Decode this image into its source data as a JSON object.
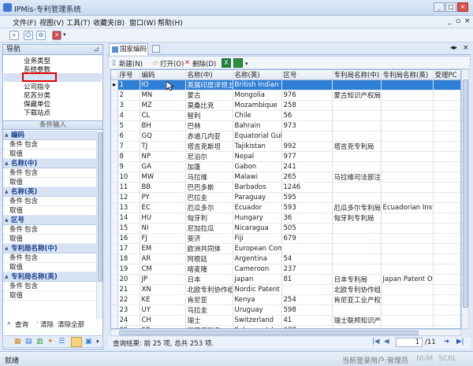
{
  "window": {
    "title": "IPMis-专利管理系统",
    "min": "_",
    "max": "□",
    "close": "×"
  },
  "menu": [
    "文件(F)",
    "视图(V)",
    "工具(T)",
    "收藏夹(B)",
    "窗口(W)",
    "帮助(H)"
  ],
  "nav": {
    "title": "导航",
    "items": [
      "业务类型",
      "系统参数",
      "",
      "公司指令",
      "尼苏分类",
      "保藏单位",
      "下载站点"
    ]
  },
  "conditions": {
    "title": "条件输入",
    "groups": [
      {
        "name": "编码",
        "rows": [
          [
            "条件",
            "包含"
          ],
          [
            "取值",
            ""
          ]
        ]
      },
      {
        "name": "名称(中)",
        "rows": [
          [
            "条件",
            "包含"
          ],
          [
            "取值",
            ""
          ]
        ]
      },
      {
        "name": "名称(英)",
        "rows": [
          [
            "条件",
            "包含"
          ],
          [
            "取值",
            ""
          ]
        ]
      },
      {
        "name": "区号",
        "rows": [
          [
            "条件",
            "包含"
          ],
          [
            "取值",
            ""
          ]
        ]
      },
      {
        "name": "专利局名称(中)",
        "rows": [
          [
            "条件",
            "包含"
          ],
          [
            "取值",
            ""
          ]
        ]
      },
      {
        "name": "专利局名称(英)",
        "rows": [
          [
            "条件",
            "包含"
          ],
          [
            "取值",
            ""
          ]
        ]
      }
    ],
    "query": "查询",
    "clear": "清除",
    "clear_all": "清除全部"
  },
  "tab": {
    "label": "国家编码"
  },
  "grid_toolbar": {
    "new": "新建(N)",
    "open": "打开(O)",
    "delete": "删除(D)"
  },
  "grid": {
    "columns": [
      "序号",
      "编码",
      "名称(中)",
      "名称(英)",
      "区号",
      "专利局名称(中)",
      "专利局名称(英)",
      "受理PC"
    ],
    "rows": [
      [
        "1",
        "IO",
        "英属印度洋领土",
        "British Indian Oc",
        "",
        "",
        "",
        ""
      ],
      [
        "2",
        "MN",
        "蒙古",
        "Mongolia",
        "976",
        "蒙古知识产权局",
        "",
        "是"
      ],
      [
        "3",
        "MZ",
        "莫桑比克",
        "Mozambique",
        "258",
        "",
        "",
        "是"
      ],
      [
        "4",
        "CL",
        "智利",
        "Chile",
        "56",
        "",
        "",
        "是"
      ],
      [
        "5",
        "BH",
        "巴林",
        "Bahrain",
        "973",
        "",
        "",
        "是"
      ],
      [
        "6",
        "GQ",
        "赤道几内亚",
        "Equatorial Guine",
        "",
        "",
        "",
        "是"
      ],
      [
        "7",
        "TJ",
        "塔吉克斯坦",
        "Tajikistan",
        "992",
        "塔吉克专利局",
        "",
        "是"
      ],
      [
        "8",
        "NP",
        "尼泊尔",
        "Nepal",
        "977",
        "",
        "",
        "是"
      ],
      [
        "9",
        "GA",
        "加蓬",
        "Gabon",
        "241",
        "",
        "",
        "是"
      ],
      [
        "10",
        "MW",
        "马拉维",
        "Malawi",
        "265",
        "马拉维司法部注所",
        "",
        "是"
      ],
      [
        "11",
        "BB",
        "巴巴多斯",
        "Barbados",
        "1246",
        "",
        "",
        "是"
      ],
      [
        "12",
        "PY",
        "巴拉圭",
        "Paraguay",
        "595",
        "",
        "",
        "是"
      ],
      [
        "13",
        "EC",
        "厄瓜多尔",
        "Ecuador",
        "593",
        "厄瓜多尔专利局",
        "Ecuadorian Insti",
        "是"
      ],
      [
        "14",
        "HU",
        "匈牙利",
        "Hungary",
        "36",
        "匈牙利专利局",
        "",
        "是"
      ],
      [
        "15",
        "NI",
        "尼加拉瓜",
        "Nicaragua",
        "505",
        "",
        "",
        "是"
      ],
      [
        "16",
        "FJ",
        "斐济",
        "Fiji",
        "679",
        "",
        "",
        "是"
      ],
      [
        "17",
        "EM",
        "欧洲共同体",
        "European Comn",
        "",
        "",
        "",
        "是"
      ],
      [
        "18",
        "AR",
        "阿根廷",
        "Argentina",
        "54",
        "",
        "",
        "是"
      ],
      [
        "19",
        "CM",
        "喀麦隆",
        "Cameroon",
        "237",
        "",
        "",
        "是"
      ],
      [
        "20",
        "JP",
        "日本",
        "Japan",
        "81",
        "日本专利局",
        "Japan Patent Offi",
        "是"
      ],
      [
        "21",
        "XN",
        "北欧专利协作组织",
        "Nordic Patent In",
        "",
        "北欧专利协作组织",
        "",
        "是"
      ],
      [
        "22",
        "KE",
        "肯尼亚",
        "Kenya",
        "254",
        "肯尼亚工业产权局",
        "",
        "是"
      ],
      [
        "23",
        "UY",
        "乌拉圭",
        "Uruguay",
        "598",
        "",
        "",
        "是"
      ],
      [
        "24",
        "CH",
        "瑞士",
        "Switzerland",
        "41",
        "瑞士联邦知识产权局",
        "",
        "是"
      ],
      [
        "25",
        "SB",
        "所罗门群岛",
        "Solomon Islands",
        "677",
        "",
        "",
        "是"
      ]
    ]
  },
  "pager": {
    "summary": "查询结果: 前 25 项, 总共 253 项.",
    "page": "1",
    "total": "/11"
  },
  "status": {
    "left": "就绪",
    "right": "当前登录用户:管理员",
    "num": "NUM",
    "scrl": "SCRL"
  }
}
